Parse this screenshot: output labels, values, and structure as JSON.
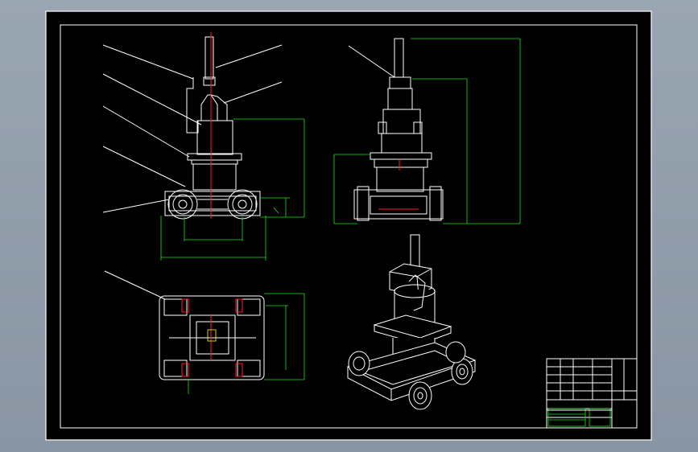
{
  "drawing": {
    "background_color": "#000000",
    "viewport_color": "#8f9aa8",
    "line_color": "#ffffff",
    "dimension_color": "#19e619",
    "centerline_color": "#ff2020"
  },
  "views": [
    {
      "id": "front-view"
    },
    {
      "id": "side-view"
    },
    {
      "id": "top-view"
    },
    {
      "id": "isometric-view"
    }
  ],
  "title_block": {
    "present": true
  }
}
